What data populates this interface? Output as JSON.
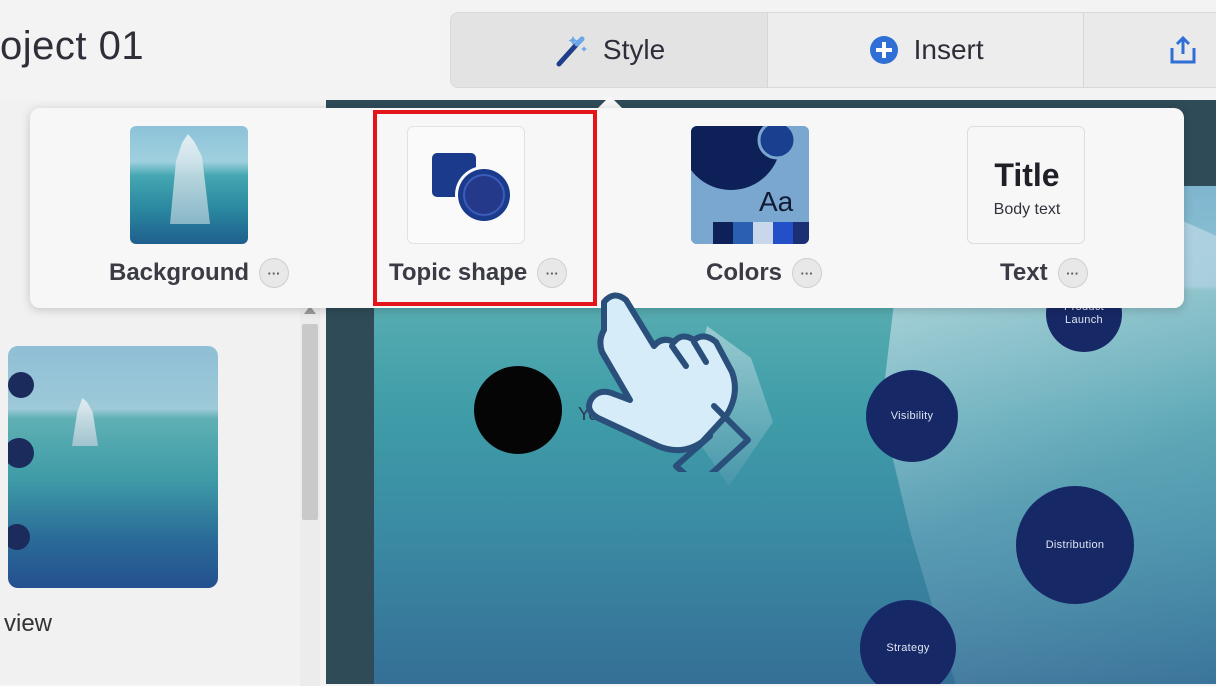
{
  "header": {
    "project_title": "oject 01",
    "tabs": [
      {
        "label": "Style",
        "icon": "magic-wand-icon"
      },
      {
        "label": "Insert",
        "icon": "plus-circle-icon"
      },
      {
        "label": "",
        "icon": "share-upload-icon"
      }
    ]
  },
  "style_menu": {
    "options": [
      {
        "label": "Background",
        "more": "···"
      },
      {
        "label": "Topic shape",
        "more": "···"
      },
      {
        "label": "Colors",
        "more": "···"
      },
      {
        "label": "Text",
        "more": "···"
      }
    ],
    "colors_preview_text": "Aa",
    "text_preview": {
      "title": "Title",
      "body": "Body text"
    }
  },
  "sidebar": {
    "thumbnail_label": "view"
  },
  "slide": {
    "subtitle": "Your",
    "topics": [
      "Product Launch",
      "Visibility",
      "Distribution",
      "Strategy"
    ]
  },
  "colors": {
    "accent_navy": "#172866",
    "highlight_red": "#e3151a",
    "plus_blue": "#2f6fd6"
  }
}
